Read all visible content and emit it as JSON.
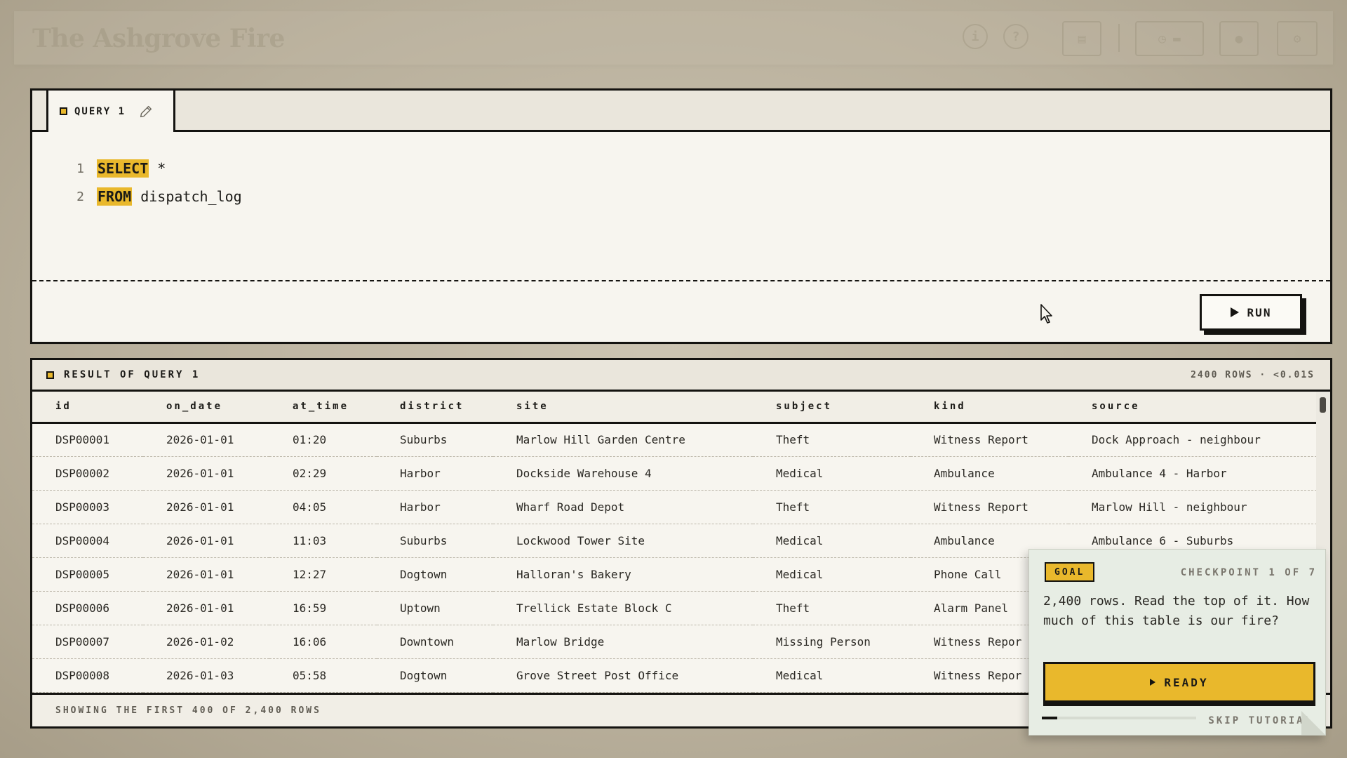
{
  "app": {
    "title": "The Ashgrove Fire"
  },
  "toolbar": {
    "icons": [
      "info-icon",
      "help-icon",
      "clipboard-icon",
      "history-icon",
      "film-icon",
      "circle-icon",
      "gear-icon"
    ]
  },
  "query": {
    "tab_label": "QUERY 1",
    "lines": [
      {
        "no": "1",
        "keyword": "SELECT",
        "rest": " *"
      },
      {
        "no": "2",
        "keyword": "FROM",
        "rest": " dispatch_log"
      }
    ],
    "run_label": "RUN"
  },
  "result": {
    "title": "RESULT OF QUERY 1",
    "meta": "2400 ROWS · <0.01S",
    "columns": [
      "id",
      "on_date",
      "at_time",
      "district",
      "site",
      "subject",
      "kind",
      "source"
    ],
    "rows": [
      [
        "DSP00001",
        "2026-01-01",
        "01:20",
        "Suburbs",
        "Marlow Hill Garden Centre",
        "Theft",
        "Witness Report",
        "Dock Approach - neighbour"
      ],
      [
        "DSP00002",
        "2026-01-01",
        "02:29",
        "Harbor",
        "Dockside Warehouse 4",
        "Medical",
        "Ambulance",
        "Ambulance 4 - Harbor"
      ],
      [
        "DSP00003",
        "2026-01-01",
        "04:05",
        "Harbor",
        "Wharf Road Depot",
        "Theft",
        "Witness Report",
        "Marlow Hill - neighbour"
      ],
      [
        "DSP00004",
        "2026-01-01",
        "11:03",
        "Suburbs",
        "Lockwood Tower Site",
        "Medical",
        "Ambulance",
        "Ambulance 6 - Suburbs"
      ],
      [
        "DSP00005",
        "2026-01-01",
        "12:27",
        "Dogtown",
        "Halloran's Bakery",
        "Medical",
        "Phone Call",
        ""
      ],
      [
        "DSP00006",
        "2026-01-01",
        "16:59",
        "Uptown",
        "Trellick Estate Block C",
        "Theft",
        "Alarm Panel",
        ""
      ],
      [
        "DSP00007",
        "2026-01-02",
        "16:06",
        "Downtown",
        "Marlow Bridge",
        "Missing Person",
        "Witness Repor",
        ""
      ],
      [
        "DSP00008",
        "2026-01-03",
        "05:58",
        "Dogtown",
        "Grove Street Post Office",
        "Medical",
        "Witness Repor",
        ""
      ]
    ],
    "footer": "SHOWING THE FIRST 400 OF 2,400 ROWS"
  },
  "goal": {
    "badge": "GOAL",
    "checkpoint": "CHECKPOINT 1 OF 7",
    "text": "2,400 rows. Read the top of it. How much of this table is our fire?",
    "ready_label": "READY",
    "skip_label": "SKIP TUTORIAL",
    "progress": 0.1
  },
  "colors": {
    "accent": "#e9b82c",
    "ink": "#141310",
    "paper": "#f7f5ef"
  }
}
